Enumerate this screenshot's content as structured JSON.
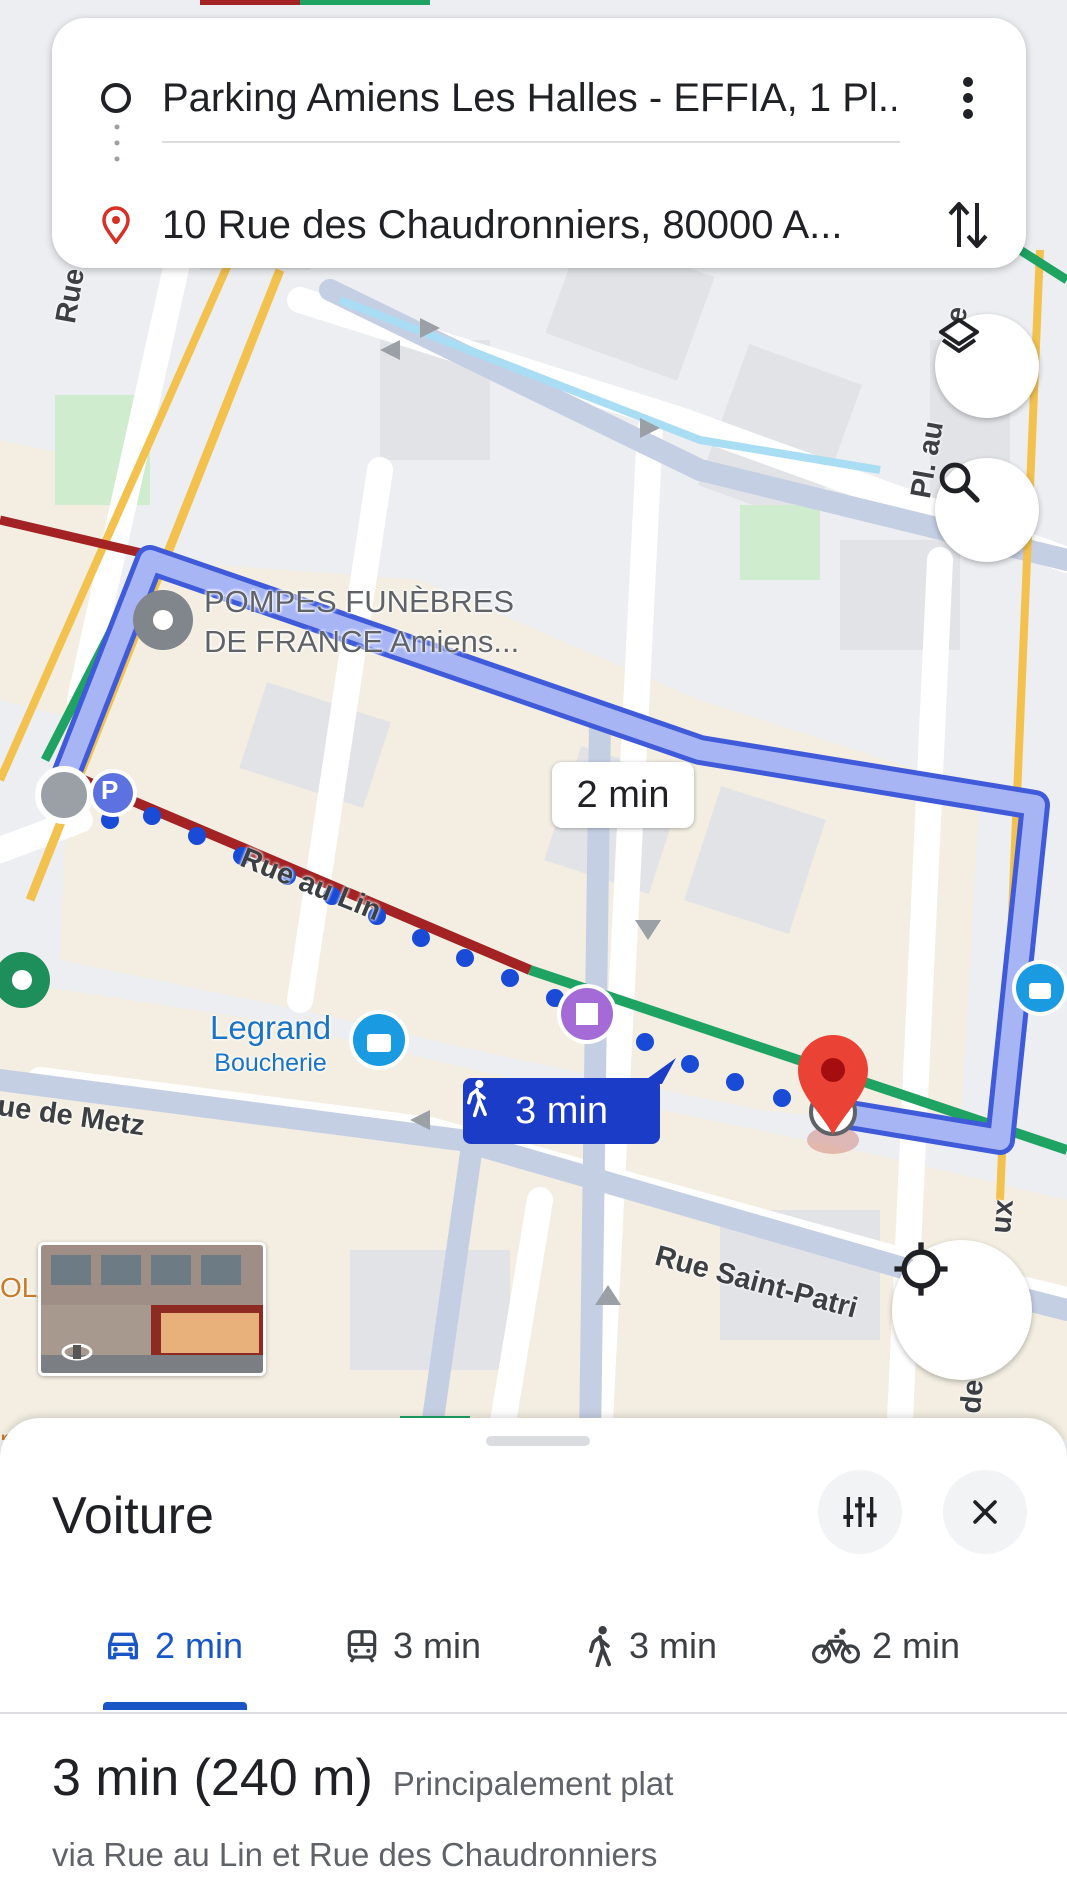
{
  "route_card": {
    "origin": "Parking Amiens Les Halles - EFFIA, 1 Pl...",
    "destination": "10 Rue des Chaudronniers, 80000 A...",
    "origin_icon": "circle-outline-icon",
    "destination_icon": "location-pin-icon",
    "menu_icon": "more-vert-icon",
    "swap_icon": "swap-vertical-icon"
  },
  "map": {
    "streets": {
      "rue_de": "Rue de",
      "pl_au": "Pl. au",
      "rue_au_lin": "Rue au Lin",
      "rue_de_metz": "ue de Metz",
      "rue_saint_patrice": "Rue Saint-Patri",
      "ux": "ux",
      "de": "de",
      "e": "e",
      "ola": "OL/",
      "r": "r"
    },
    "poi": {
      "pompes_funebres_line1": "POMPES FUNÈBRES",
      "pompes_funebres_line2": "DE FRANCE Amiens...",
      "legrand_name": "Legrand",
      "legrand_type": "Boucherie",
      "parking_letter": "P"
    },
    "alt_route_badge": "2 min",
    "walk_badge": "3 min",
    "colors": {
      "route": "#a7b5f5",
      "route_outline": "#3f5bd9",
      "walk_dots": "#1a4bd6",
      "traffic_green": "#1ea362",
      "traffic_red": "#a32224",
      "traffic_yellow": "#f2c14e",
      "road": "#ffffff",
      "block": "#f0ead8",
      "building": "#e3e4e8",
      "park": "#cdeccf",
      "water": "#a9ddf3",
      "pin": "#ea4335"
    }
  },
  "controls": {
    "layers_icon": "layers-icon",
    "search_icon": "search-icon",
    "locate_icon": "my-location-icon",
    "streetview_icon": "street-view-rotate-icon"
  },
  "sheet": {
    "title": "Voiture",
    "filter_icon": "tune-icon",
    "close_icon": "close-icon",
    "tabs": [
      {
        "icon": "car-icon",
        "label": "2 min",
        "active": true
      },
      {
        "icon": "transit-icon",
        "label": "3 min",
        "active": false
      },
      {
        "icon": "walk-icon",
        "label": "3 min",
        "active": false
      },
      {
        "icon": "bike-icon",
        "label": "2 min",
        "active": false
      }
    ],
    "summary_time": "3 min (240 m)",
    "summary_note": "Principalement plat",
    "summary_via": "via Rue au Lin et Rue des Chaudronniers"
  }
}
